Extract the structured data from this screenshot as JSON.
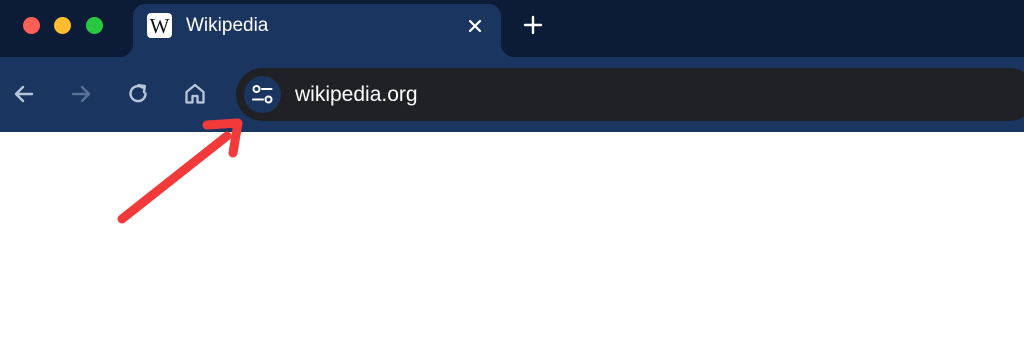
{
  "window": {
    "traffic_lights": [
      "close",
      "minimize",
      "zoom"
    ]
  },
  "tab": {
    "favicon_letter": "W",
    "title": "Wikipedia",
    "close_icon": "close-icon"
  },
  "toolbar": {
    "back_icon": "arrow-left-icon",
    "forward_icon": "arrow-right-icon",
    "reload_icon": "reload-icon",
    "home_icon": "home-icon",
    "new_tab_icon": "plus-icon"
  },
  "omnibox": {
    "site_info_icon": "tune-icon",
    "url": "wikipedia.org"
  },
  "annotation": {
    "arrow_color": "#f23a3a",
    "points_to": "site-info-button"
  },
  "colors": {
    "titlebar": "#0c1b36",
    "toolbar": "#1b3561",
    "omnibox": "#202124"
  }
}
